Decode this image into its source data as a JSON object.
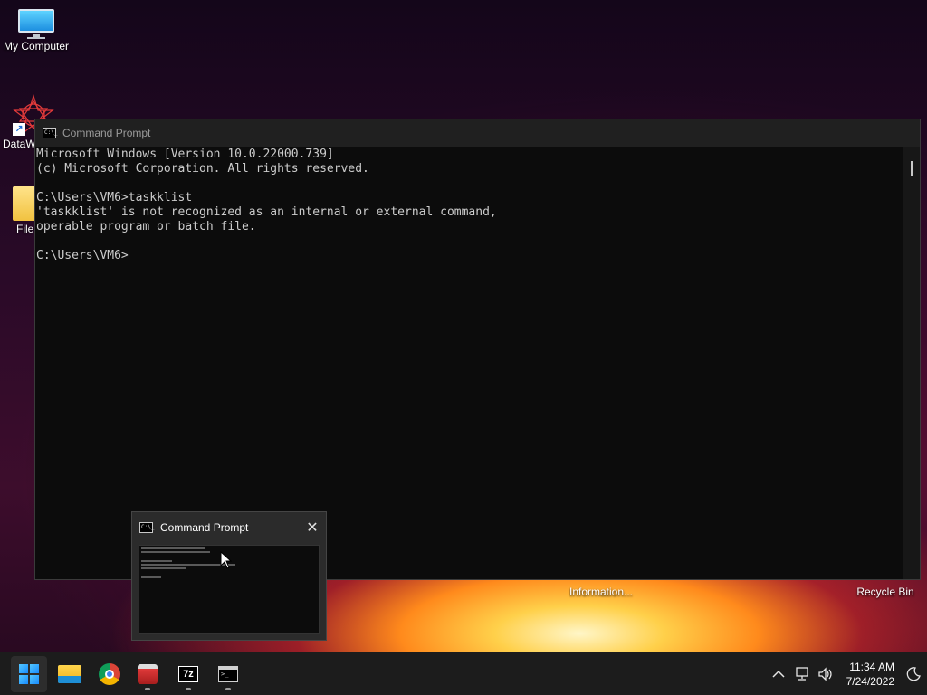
{
  "desktop": {
    "icons": [
      {
        "label": "My Computer"
      },
      {
        "label": "DataW"
      },
      {
        "label": "File"
      },
      {
        "label": "Information..."
      },
      {
        "label": "Recycle Bin"
      }
    ]
  },
  "cmd_window": {
    "title": "Command Prompt",
    "lines": [
      "Microsoft Windows [Version 10.0.22000.739]",
      "(c) Microsoft Corporation. All rights reserved.",
      "",
      "C:\\Users\\VM6>taskklist",
      "'taskklist' is not recognized as an internal or external command,",
      "operable program or batch file.",
      "",
      "C:\\Users\\VM6>"
    ]
  },
  "preview": {
    "title": "Command Prompt",
    "close_icon": "close-icon"
  },
  "taskbar": {
    "apps": [
      "start",
      "file-explorer",
      "chrome",
      "toolbox",
      "7-zip",
      "command-prompt"
    ],
    "zip_label": "7z",
    "clock_time": "11:34 AM",
    "clock_date": "7/24/2022"
  },
  "colors": {
    "console_bg": "#0c0c0c",
    "console_text": "#cccccc",
    "taskbar_bg": "#1c1c1c"
  }
}
